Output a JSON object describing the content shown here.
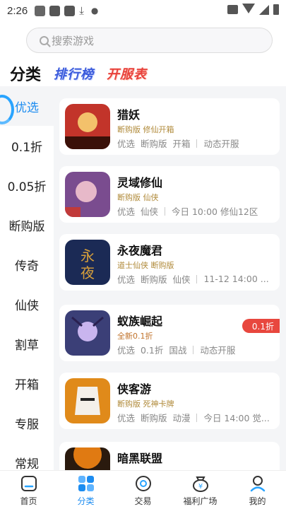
{
  "status_bar": {
    "time": "2:26"
  },
  "search": {
    "placeholder": "搜索游戏"
  },
  "header": {
    "category": "分类",
    "ranking": "排行榜",
    "open_server": "开服表"
  },
  "sidebar": {
    "items": [
      {
        "label": "优选",
        "active": true
      },
      {
        "label": "0.1折"
      },
      {
        "label": "0.05折"
      },
      {
        "label": "断购版"
      },
      {
        "label": "传奇"
      },
      {
        "label": "仙侠"
      },
      {
        "label": "割草"
      },
      {
        "label": "开箱"
      },
      {
        "label": "专服"
      },
      {
        "label": "常规"
      }
    ]
  },
  "games": [
    {
      "name": "猎妖",
      "tags": "断购版 修仙开箱",
      "meta": [
        "优选",
        "断购版",
        "开箱"
      ],
      "extra": "动态开服",
      "badge": "",
      "colors": [
        "#c2342a",
        "#f3c16b"
      ]
    },
    {
      "name": "灵域修仙",
      "tags": "断购版 仙侠",
      "meta": [
        "优选",
        "仙侠"
      ],
      "extra": "今日 10:00 修仙12区",
      "badge": "",
      "colors": [
        "#7a4c8f",
        "#e7b9c9"
      ]
    },
    {
      "name": "永夜魔君",
      "tags": "道士仙侠 断购版",
      "meta": [
        "优选",
        "断购版",
        "仙侠"
      ],
      "extra": "11-12 14:00 ...",
      "badge": "",
      "colors": [
        "#1b2a55",
        "#d8a03a"
      ]
    },
    {
      "name": "蚁族崛起",
      "tags": "全新0.1折",
      "meta": [
        "优选",
        "0.1折",
        "国战"
      ],
      "extra": "动态开服",
      "badge": "0.1折",
      "colors": [
        "#3b3f77",
        "#c9b5ef"
      ]
    },
    {
      "name": "侠客游",
      "tags": "断购版 死神卡牌",
      "meta": [
        "优选",
        "断购版",
        "动漫"
      ],
      "extra": "今日 14:00 觉...",
      "badge": "",
      "colors": [
        "#e08a1a",
        "#f4f0ea"
      ]
    },
    {
      "name": "暗黑联盟",
      "tags": "",
      "meta": [],
      "extra": "",
      "badge": "",
      "colors": [
        "#e07a12",
        "#2a1a0e"
      ]
    }
  ],
  "bottom_nav": [
    {
      "label": "首页",
      "icon": "home-icon"
    },
    {
      "label": "分类",
      "icon": "category-grid-icon",
      "active": true
    },
    {
      "label": "交易",
      "icon": "trade-icon"
    },
    {
      "label": "福利广场",
      "icon": "welfare-bag-icon"
    },
    {
      "label": "我的",
      "icon": "profile-icon"
    }
  ],
  "colors": {
    "accent": "#1c8cf0",
    "badge": "#e8473e",
    "tag": "#b08a3a"
  }
}
